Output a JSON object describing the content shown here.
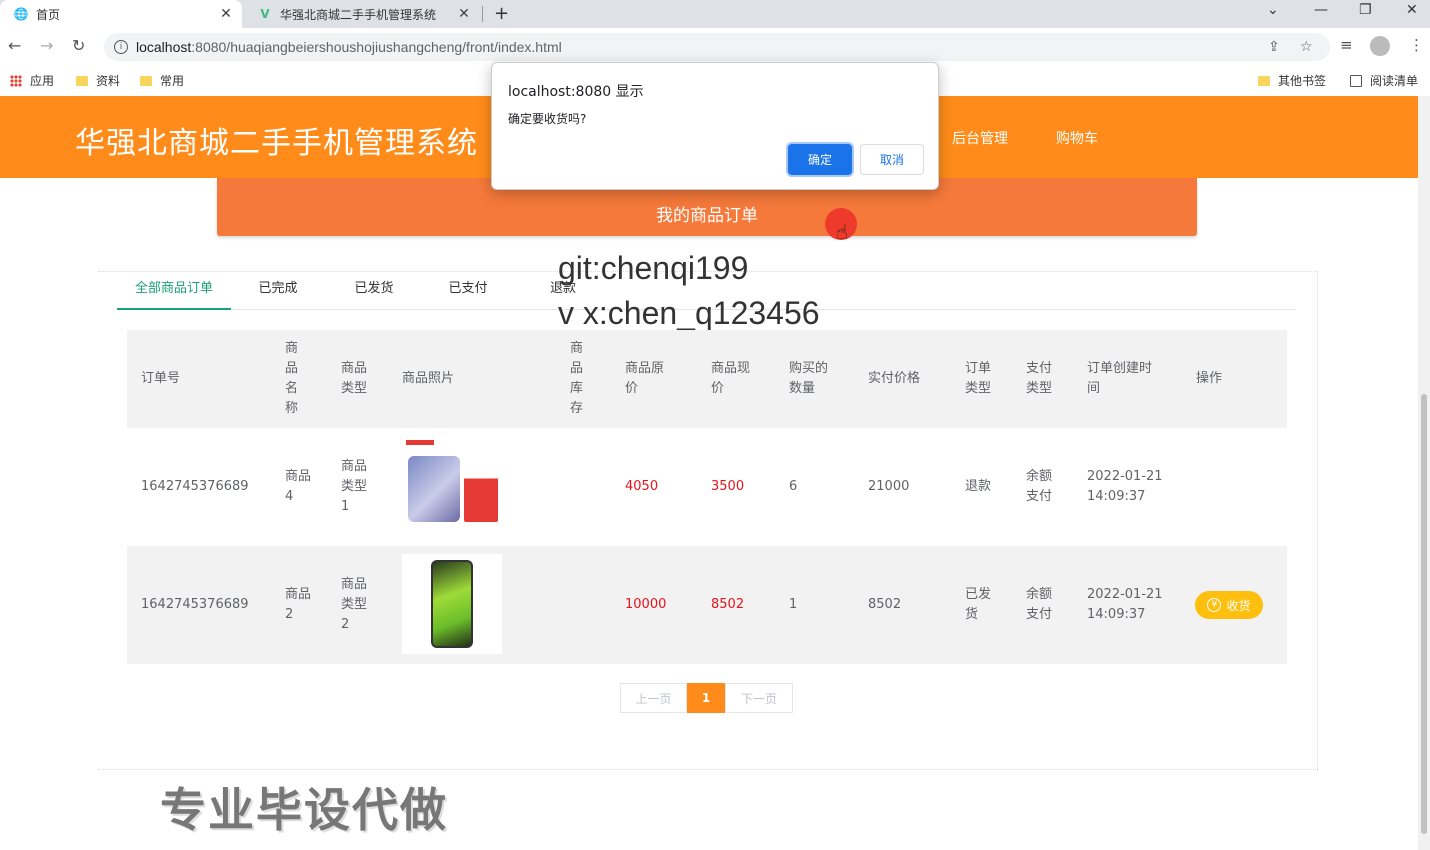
{
  "browser": {
    "tabs": [
      {
        "title": "首页",
        "icon": "globe-icon"
      },
      {
        "title": "华强北商城二手手机管理系统",
        "icon": "vue-logo-icon"
      }
    ],
    "url_host": "localhost",
    "url_rest": ":8080/huaqiangbeiershoushojiushangcheng/front/index.html",
    "bookmarks": [
      "应用",
      "资料",
      "常用"
    ],
    "bookmarks_right": [
      "其他书签",
      "阅读清单"
    ]
  },
  "header": {
    "title": "华强北商城二手手机管理系统",
    "nav": [
      "后台管理",
      "购物车"
    ],
    "brand_color": "#ff8c1a"
  },
  "banner": {
    "title": "我的商品订单"
  },
  "overlay": {
    "line1": "git:chenqi199",
    "line2": "v x:chen_q123456"
  },
  "order_tabs": [
    "全部商品订单",
    "已完成",
    "已发货",
    "已支付",
    "退款"
  ],
  "table": {
    "headers": {
      "order_no": "订单号",
      "name": "商品名称",
      "type": "商品类型",
      "photo": "商品照片",
      "stock": "商品库存",
      "orig_price": "商品原价",
      "cur_price": "商品现价",
      "qty": "购买的数量",
      "paid": "实付价格",
      "order_type": "订单类型",
      "pay_type": "支付类型",
      "created": "订单创建时间",
      "action": "操作"
    },
    "rows": [
      {
        "order_no": "1642745376689",
        "name": "商品4",
        "type": "商品类型1",
        "orig_price": "4050",
        "cur_price": "3500",
        "qty": "6",
        "paid": "21000",
        "order_type": "退款",
        "pay_type": "余额支付",
        "created": "2022-01-21 14:09:37",
        "action": ""
      },
      {
        "order_no": "1642745376689",
        "name": "商品2",
        "type": "商品类型2",
        "orig_price": "10000",
        "cur_price": "8502",
        "qty": "1",
        "paid": "8502",
        "order_type": "已发货",
        "pay_type": "余额支付",
        "created": "2022-01-21 14:09:37",
        "action": "收货"
      }
    ]
  },
  "pager": {
    "prev": "上一页",
    "current": "1",
    "next": "下一页"
  },
  "watermark": "专业毕设代做",
  "dialog": {
    "title": "localhost:8080 显示",
    "message": "确定要收货吗?",
    "ok": "确定",
    "cancel": "取消"
  }
}
